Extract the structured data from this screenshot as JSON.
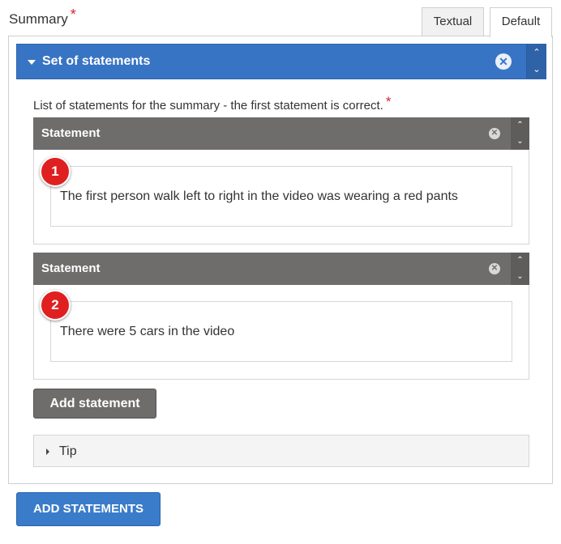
{
  "field": {
    "label": "Summary",
    "required_mark": "*"
  },
  "tabs": [
    {
      "label": "Textual"
    },
    {
      "label": "Default"
    }
  ],
  "group": {
    "title": "Set of statements",
    "remove_icon": "circle-x-icon",
    "order_up_icon": "chevron-up-icon",
    "order_down_icon": "chevron-down-icon",
    "description": "List of statements for the summary - the first statement is correct.",
    "description_required_mark": "*",
    "statements": [
      {
        "header": "Statement",
        "badge": "1",
        "value": "The first person walk left to right in the video was wearing a red pants"
      },
      {
        "header": "Statement",
        "badge": "2",
        "value": "There were 5 cars in the video"
      }
    ],
    "add_button_label": "Add statement",
    "tip_label": "Tip"
  },
  "add_group_button_label": "ADD STATEMENTS",
  "colors": {
    "accent": "#3874c4",
    "statement_header": "#6f6c6c",
    "badge": "#e02020",
    "required": "#d9262e"
  }
}
